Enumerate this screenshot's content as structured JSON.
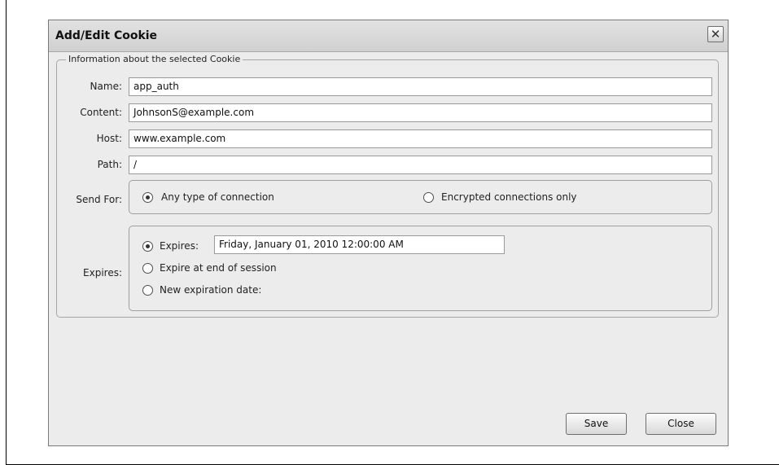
{
  "dialog": {
    "title": "Add/Edit Cookie",
    "close_glyph": "✕",
    "group_title": "Information about the selected Cookie"
  },
  "fields": {
    "name_label": "Name:",
    "name_value": "app_auth",
    "content_label": "Content:",
    "content_value": "JohnsonS@example.com",
    "host_label": "Host:",
    "host_value": "www.example.com",
    "path_label": "Path:",
    "path_value": "/"
  },
  "send_for": {
    "label": "Send For:",
    "options": [
      {
        "label": "Any type of connection",
        "checked": true
      },
      {
        "label": "Encrypted connections only",
        "checked": false
      }
    ]
  },
  "expires": {
    "label": "Expires:",
    "options": [
      {
        "label": "Expires:",
        "checked": true
      },
      {
        "label": "Expire at end of session",
        "checked": false
      },
      {
        "label": "New expiration date:",
        "checked": false
      }
    ],
    "date_value": "Friday, January 01, 2010 12:00:00 AM"
  },
  "buttons": {
    "save": "Save",
    "close": "Close"
  }
}
